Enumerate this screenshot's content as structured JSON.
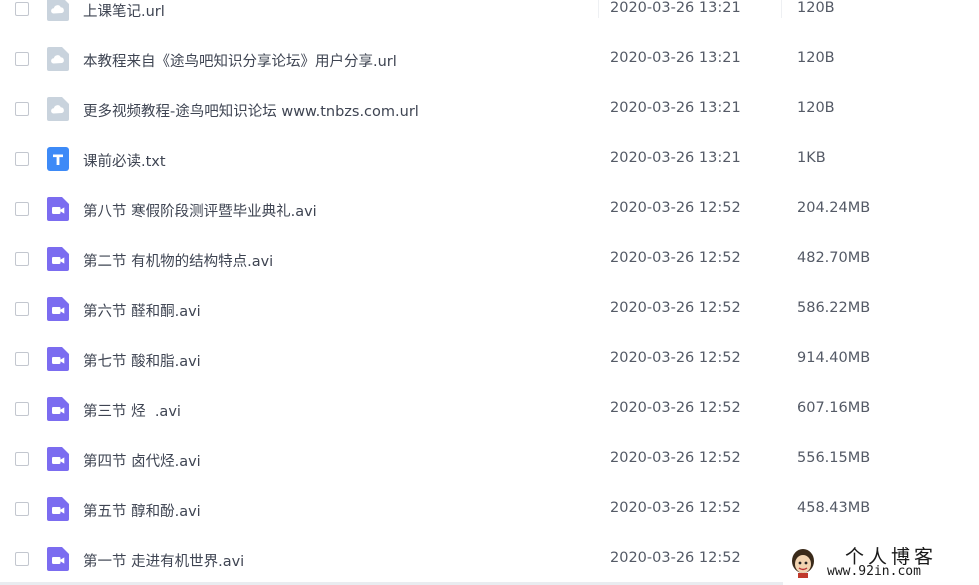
{
  "files": [
    {
      "name": "上课笔记.url",
      "date": "2020-03-26 13:21",
      "size": "120B",
      "icon": "link-file-icon"
    },
    {
      "name": "本教程来自《途鸟吧知识分享论坛》用户分享.url",
      "date": "2020-03-26 13:21",
      "size": "120B",
      "icon": "link-file-icon"
    },
    {
      "name": "更多视频教程-途鸟吧知识论坛 www.tnbzs.com.url",
      "date": "2020-03-26 13:21",
      "size": "120B",
      "icon": "link-file-icon"
    },
    {
      "name": "课前必读.txt",
      "date": "2020-03-26 13:21",
      "size": "1KB",
      "icon": "text-file-icon"
    },
    {
      "name": "第八节 寒假阶段测评暨毕业典礼.avi",
      "date": "2020-03-26 12:52",
      "size": "204.24MB",
      "icon": "video-file-icon"
    },
    {
      "name": "第二节 有机物的结构特点.avi",
      "date": "2020-03-26 12:52",
      "size": "482.70MB",
      "icon": "video-file-icon"
    },
    {
      "name": "第六节 醛和酮.avi",
      "date": "2020-03-26 12:52",
      "size": "586.22MB",
      "icon": "video-file-icon"
    },
    {
      "name": "第七节 酸和脂.avi",
      "date": "2020-03-26 12:52",
      "size": "914.40MB",
      "icon": "video-file-icon"
    },
    {
      "name": "第三节 烃  .avi",
      "date": "2020-03-26 12:52",
      "size": "607.16MB",
      "icon": "video-file-icon"
    },
    {
      "name": "第四节 卤代烃.avi",
      "date": "2020-03-26 12:52",
      "size": "556.15MB",
      "icon": "video-file-icon"
    },
    {
      "name": "第五节 醇和酚.avi",
      "date": "2020-03-26 12:52",
      "size": "458.43MB",
      "icon": "video-file-icon"
    },
    {
      "name": "第一节 走进有机世界.avi",
      "date": "2020-03-26 12:52",
      "size": "",
      "icon": "video-file-icon"
    }
  ],
  "watermark": {
    "title": "个人博客",
    "url": "www.92in.com"
  },
  "colors": {
    "link_icon": "#c9d3dd",
    "text_icon": "#3d8af7",
    "video_icon": "#7b6cf0"
  }
}
